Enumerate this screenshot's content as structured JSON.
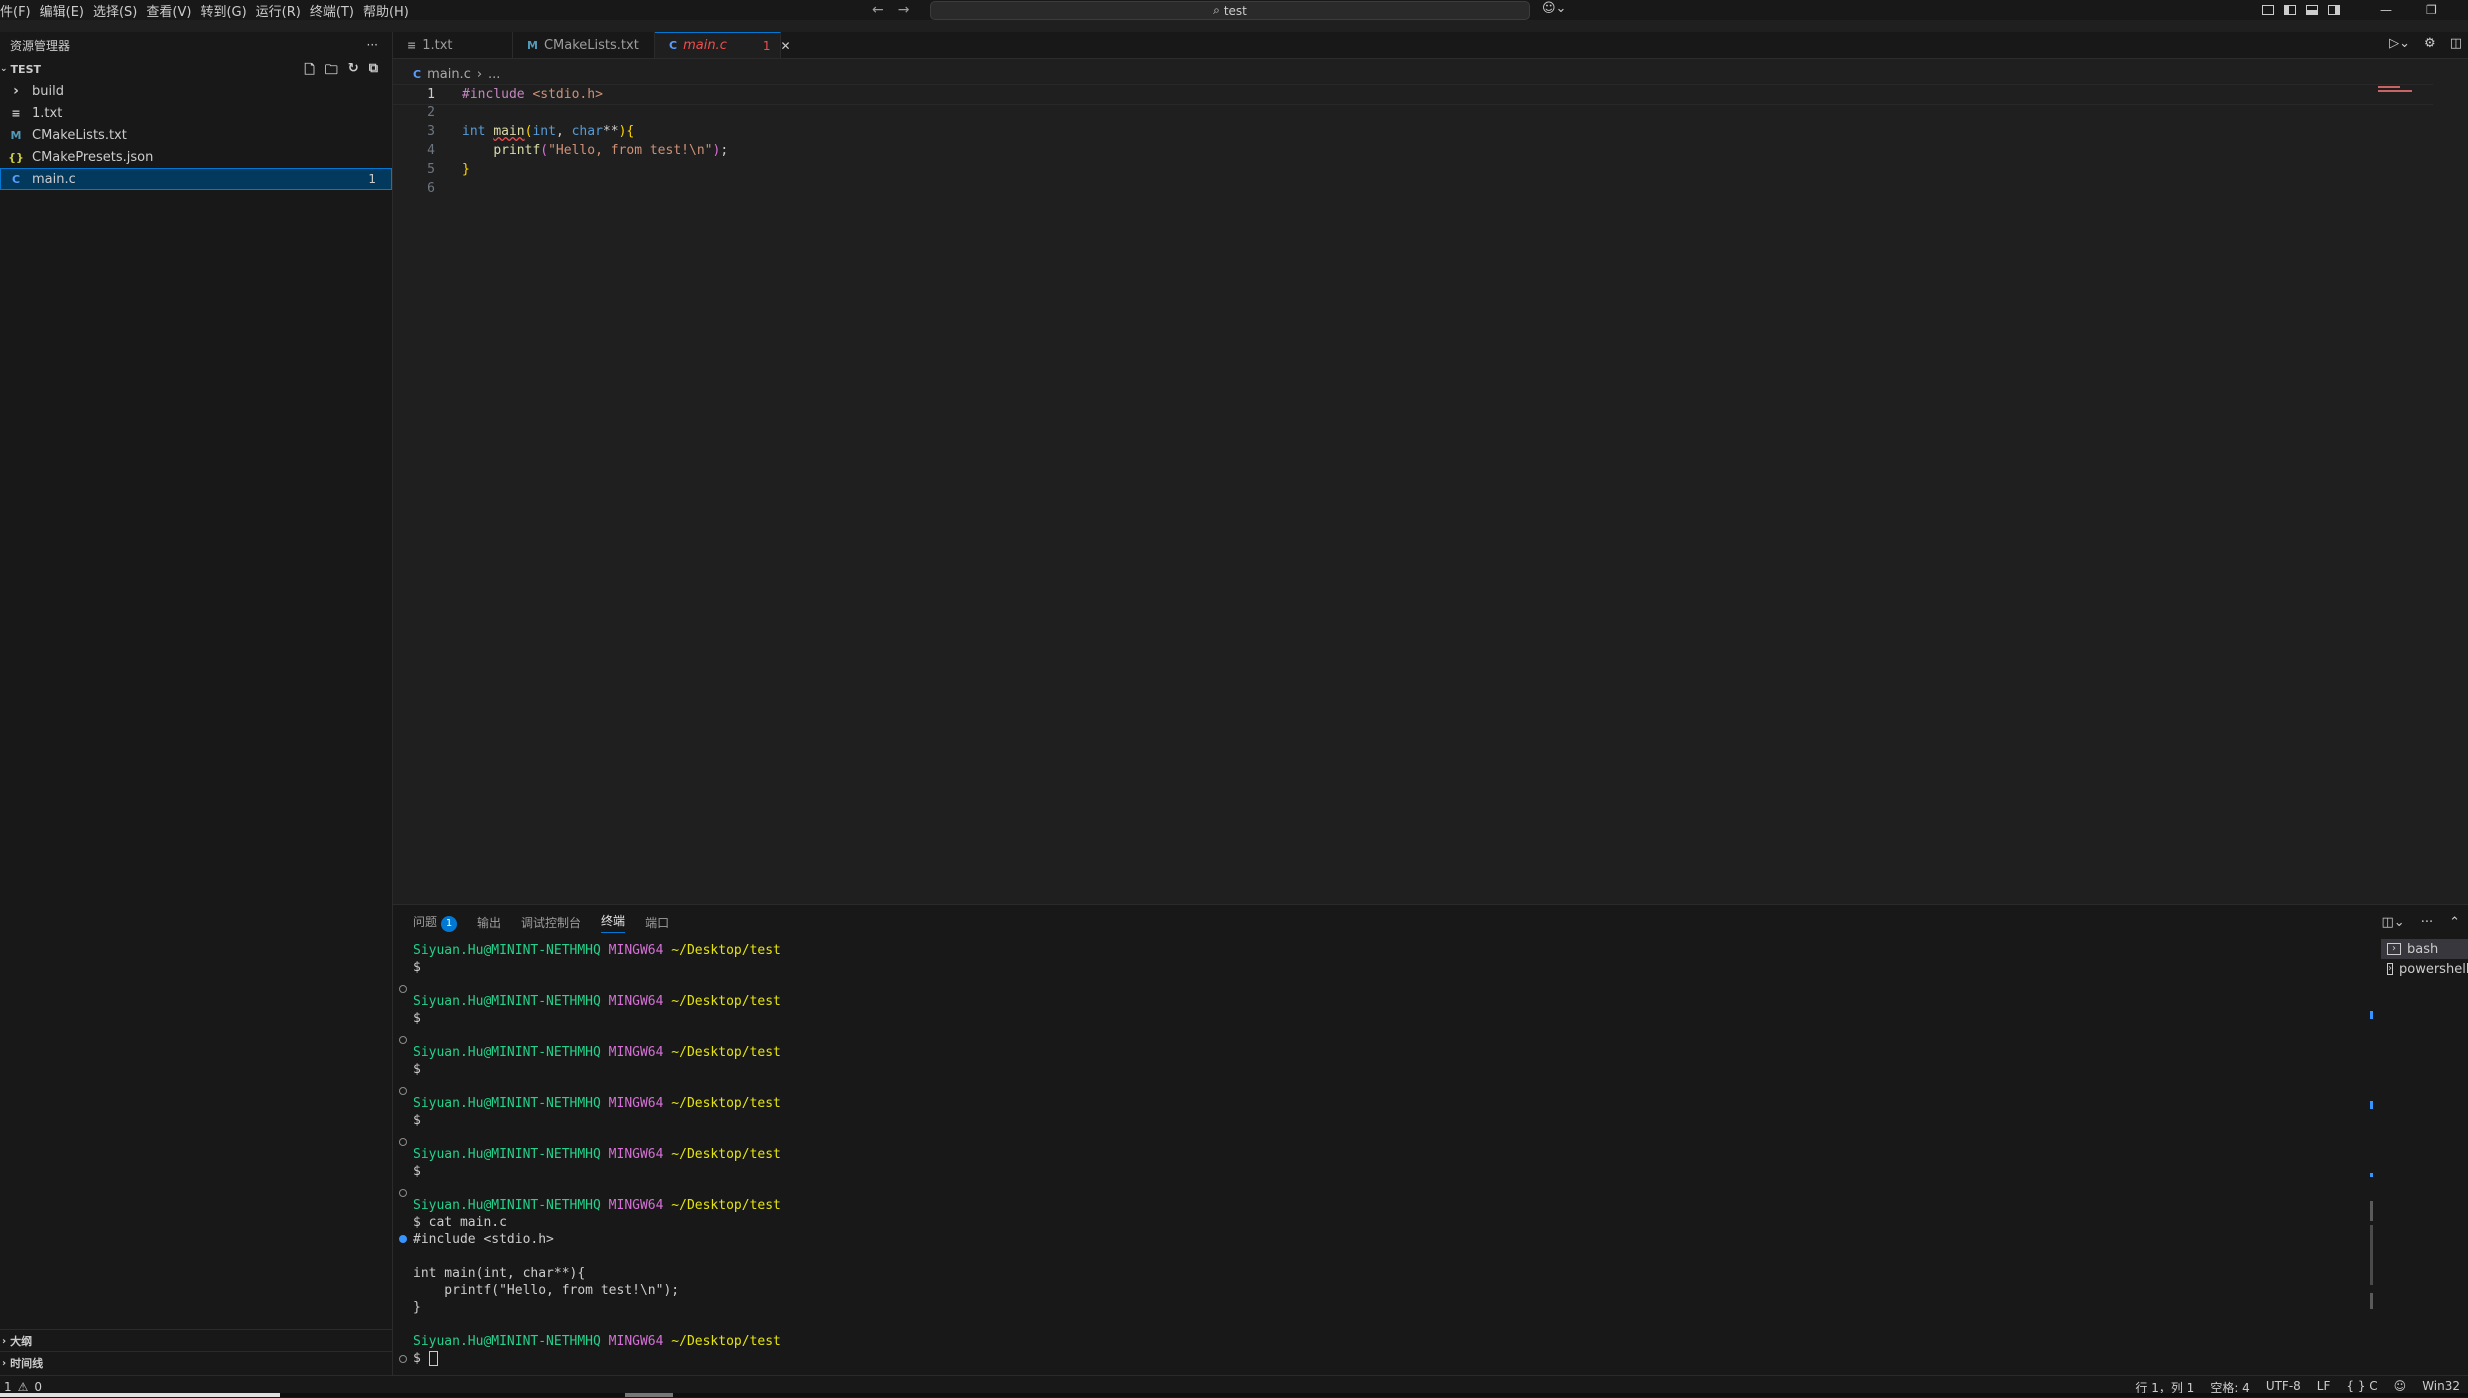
{
  "menu": [
    "件(F)",
    "编辑(E)",
    "选择(S)",
    "查看(V)",
    "转到(G)",
    "运行(R)",
    "终端(T)",
    "帮助(H)"
  ],
  "search": {
    "text": "test"
  },
  "sidebar": {
    "title": "资源管理器",
    "folder": "TEST",
    "items": [
      {
        "label": "build",
        "icon": "chevron-right-icon",
        "glyph": "›"
      },
      {
        "label": "1.txt",
        "icon": "text-file-icon",
        "glyph": "≡"
      },
      {
        "label": "CMakeLists.txt",
        "icon": "cmake-icon",
        "glyph": "M"
      },
      {
        "label": "CMakePresets.json",
        "icon": "json-icon",
        "glyph": "{}"
      },
      {
        "label": "main.c",
        "icon": "c-file-icon",
        "glyph": "C",
        "badge": "1"
      }
    ],
    "outline": "大纲",
    "timeline": "时间线"
  },
  "tabs": [
    {
      "label": "1.txt",
      "glyph": "≡"
    },
    {
      "label": "CMakeLists.txt",
      "glyph": "M"
    },
    {
      "label": "main.c",
      "glyph": "C",
      "badge": "1",
      "close": "✕"
    }
  ],
  "breadcrumb": {
    "file": "main.c",
    "sep": "›",
    "rest": "..."
  },
  "editor": {
    "line_numbers": [
      "1",
      "2",
      "3",
      "4",
      "5",
      "6"
    ]
  },
  "panel": {
    "tabs": [
      "问题",
      "输出",
      "调试控制台",
      "终端",
      "端口"
    ],
    "problems_count": "1",
    "terminal_lines": {
      "user": "Siyuan.Hu@MININT-NETHMHQ",
      "env": "MINGW64",
      "path": "~/Desktop/test",
      "prompt": "$",
      "cmd": "$ cat main.c",
      "out1": "#include <stdio.h>",
      "out3": "int main(int, char**){",
      "out4": "    printf(\"Hello, from test!\\n\");",
      "out5": "}"
    },
    "terminals": [
      "bash",
      "powershell"
    ]
  },
  "status": {
    "errors": "1",
    "warnings": "0",
    "position": "行 1，列 1",
    "spaces": "空格: 4",
    "encoding": "UTF-8",
    "eol": "LF",
    "lang": "{ } C",
    "platform": "Win32"
  },
  "colors": {
    "accent": "#0078d4",
    "error": "#f14c4c",
    "terminal_user": "#23d18b",
    "terminal_env": "#d670d6",
    "terminal_path": "#e5e510"
  }
}
